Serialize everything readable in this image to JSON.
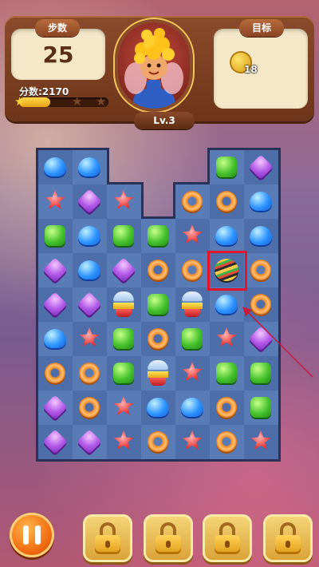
{
  "hud": {
    "moves_tab": "步数",
    "moves_value": "25",
    "goal_tab": "目标",
    "goal_count": "18",
    "goal_icon": "gold-coin-icon",
    "score_label": "分数:2170",
    "score_progress": 0.35,
    "stars_filled": 1,
    "stars_total": 3,
    "level": "Lv.3",
    "avatar": "curly-haired-fairy-boy-avatar"
  },
  "board": {
    "columns": 7,
    "rows": 9,
    "cells": [
      [
        "blue",
        "blue",
        "void",
        "void",
        "void",
        "green",
        "purple"
      ],
      [
        "red",
        "purple",
        "red",
        "void",
        "donut",
        "donut",
        "blue"
      ],
      [
        "green",
        "blue",
        "green",
        "green",
        "red",
        "blue",
        "blue"
      ],
      [
        "purple",
        "blue",
        "purple",
        "donut",
        "donut",
        "striped",
        "donut"
      ],
      [
        "purple",
        "purple",
        "capsule",
        "green",
        "capsule",
        "blue",
        "donut"
      ],
      [
        "blue",
        "red",
        "green",
        "donut",
        "green",
        "red",
        "purple"
      ],
      [
        "donut",
        "donut",
        "green",
        "capsule",
        "red",
        "green",
        "green"
      ],
      [
        "purple",
        "donut",
        "red",
        "blue",
        "blue",
        "donut",
        "green"
      ],
      [
        "purple",
        "purple",
        "red",
        "donut",
        "red",
        "donut",
        "red"
      ]
    ],
    "highlight": {
      "row": 3,
      "col": 5,
      "color": "#e3132a"
    },
    "hint": "arrow-pointing-to-candy"
  },
  "bottom_bar": {
    "pause_icon": "pause-icon",
    "locked_slots": 4,
    "lock_icon": "padlock-icon"
  },
  "colors": {
    "hud_frame": "#6d3519",
    "panel": "#f5e8c8",
    "board_bg": "#2a3357",
    "accent_orange": "#f06a10"
  }
}
